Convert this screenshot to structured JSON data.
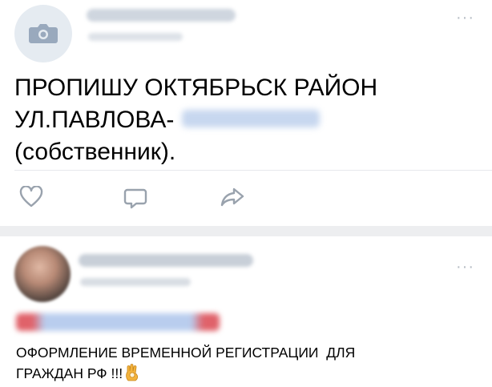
{
  "post1": {
    "text": "ПРОПИШУ ОКТЯБРЬСК РАЙОН\nУЛ.ПАВЛОВА-",
    "text_end": "\n(собственник).",
    "more": "···",
    "actions": [
      "like",
      "comment",
      "share"
    ]
  },
  "post2": {
    "text_line1": "ОФОРМЛЕНИЕ ВРЕМЕННОЙ РЕГИСТРАЦИИ  ДЛЯ",
    "text_line2": "ГРАЖДАН РФ !!!",
    "more": "···"
  },
  "colors": {
    "accent": "#5181b8",
    "icon": "#99a2ad",
    "separator": "#edeef0"
  },
  "icons": {
    "avatar_placeholder": "camera-icon",
    "like": "heart-icon",
    "comment": "comment-icon",
    "share": "share-icon",
    "emoji": "ok-hand-emoji"
  }
}
